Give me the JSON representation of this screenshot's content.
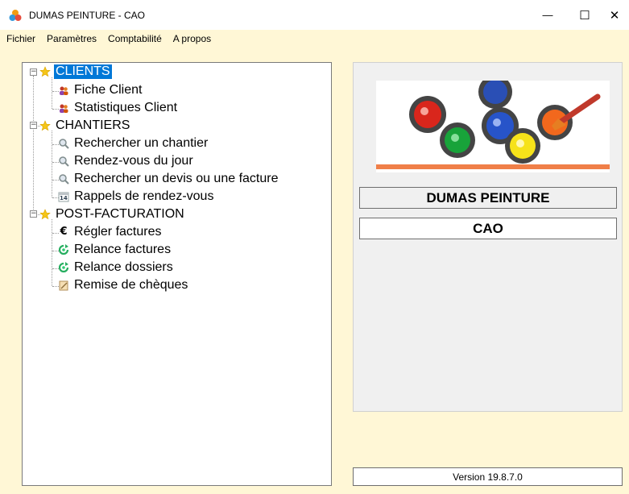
{
  "window": {
    "title": "DUMAS PEINTURE - CAO",
    "min_glyph": "—",
    "max_glyph": "☐",
    "close_glyph": "✕"
  },
  "menu": [
    "Fichier",
    "Paramètres",
    "Comptabilité",
    "A propos"
  ],
  "tree": {
    "groups": [
      {
        "label": "CLIENTS",
        "selected": true,
        "items": [
          {
            "label": "Fiche Client",
            "icon": "people-icon"
          },
          {
            "label": "Statistiques Client",
            "icon": "people-icon"
          }
        ]
      },
      {
        "label": "CHANTIERS",
        "selected": false,
        "items": [
          {
            "label": "Rechercher un chantier",
            "icon": "magnifier-icon"
          },
          {
            "label": "Rendez-vous du jour",
            "icon": "magnifier-icon"
          },
          {
            "label": "Rechercher un devis ou une facture",
            "icon": "magnifier-icon"
          },
          {
            "label": "Rappels de rendez-vous",
            "icon": "calendar-icon"
          }
        ]
      },
      {
        "label": "POST-FACTURATION",
        "selected": false,
        "items": [
          {
            "label": "Régler factures",
            "icon": "euro-icon"
          },
          {
            "label": "Relance factures",
            "icon": "refresh-icon"
          },
          {
            "label": "Relance dossiers",
            "icon": "refresh-icon"
          },
          {
            "label": "Remise de chèques",
            "icon": "notepad-icon"
          }
        ]
      }
    ],
    "calendar_day": "14",
    "euro_glyph": "€"
  },
  "info": {
    "company": "DUMAS PEINTURE",
    "product": "CAO",
    "version": "Version 19.8.7.0"
  },
  "colors": {
    "background": "#fff7d6",
    "selection": "#0078d7",
    "star": "#f5c518"
  }
}
